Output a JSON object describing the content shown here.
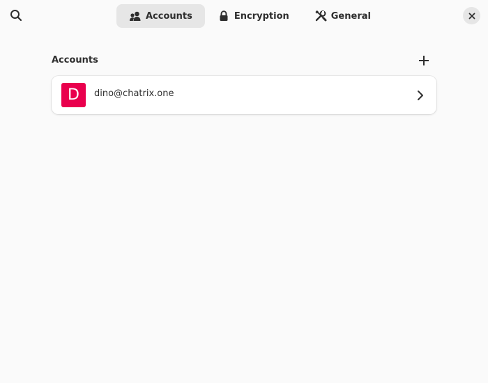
{
  "header": {
    "search_icon": "search-icon",
    "close_icon": "close-icon",
    "tabs": [
      {
        "label": "Accounts",
        "icon": "people-icon",
        "active": true
      },
      {
        "label": "Encryption",
        "icon": "lock-icon",
        "active": false
      },
      {
        "label": "General",
        "icon": "wrench-screwdriver-icon",
        "active": false
      }
    ]
  },
  "accounts": {
    "title": "Accounts",
    "add_icon": "plus-icon",
    "items": [
      {
        "avatar_letter": "D",
        "avatar_color": "#e9004d",
        "address": "dino@chatrix.one"
      }
    ]
  },
  "colors": {
    "background": "#fafafa",
    "active_tab": "#e6e6e6",
    "card": "#ffffff",
    "avatar": "#e9004d"
  }
}
